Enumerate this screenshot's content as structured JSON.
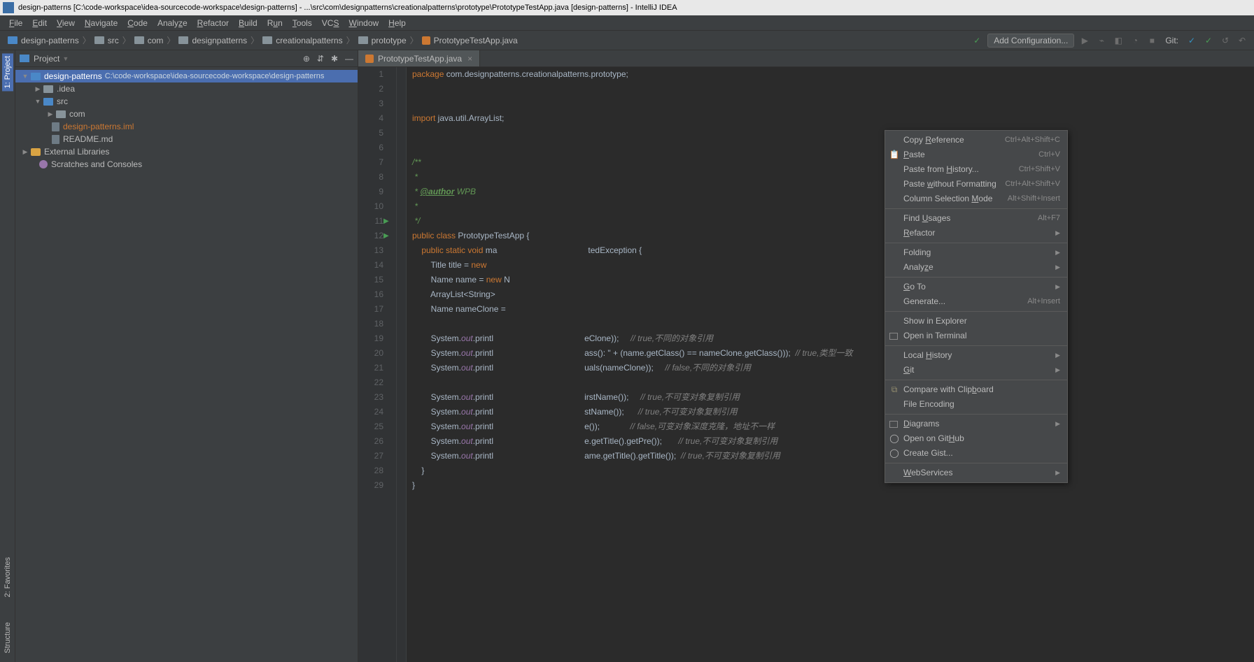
{
  "title": "design-patterns [C:\\code-workspace\\idea-sourcecode-workspace\\design-patterns] - ...\\src\\com\\designpatterns\\creationalpatterns\\prototype\\PrototypeTestApp.java [design-patterns] - IntelliJ IDEA",
  "menu": [
    "File",
    "Edit",
    "View",
    "Navigate",
    "Code",
    "Analyze",
    "Refactor",
    "Build",
    "Run",
    "Tools",
    "VCS",
    "Window",
    "Help"
  ],
  "breadcrumbs": [
    "design-patterns",
    "src",
    "com",
    "designpatterns",
    "creationalpatterns",
    "prototype",
    "PrototypeTestApp.java"
  ],
  "add_config": "Add Configuration...",
  "git_label": "Git:",
  "left_tabs": [
    "1: Project",
    "2: Favorites",
    "Structure"
  ],
  "project_header": "Project",
  "tree": {
    "root": "design-patterns",
    "root_path": "C:\\code-workspace\\idea-sourcecode-workspace\\design-patterns",
    "idea": ".idea",
    "src": "src",
    "com": "com",
    "iml": "design-patterns.iml",
    "readme": "README.md",
    "ext_lib": "External Libraries",
    "scratch": "Scratches and Consoles"
  },
  "tab_name": "PrototypeTestApp.java",
  "code_lines": {
    "l1_kw": "package",
    "l1_rest": " com.designpatterns.creationalpatterns.prototype;",
    "l4_kw": "import",
    "l4_rest": " java.util.ArrayList;",
    "l7": "/**",
    "l8": " *",
    "l9_pre": " * ",
    "l9_auth": "@author",
    "l9_post": " WPB",
    "l10": " *",
    "l11": " */",
    "l12_a": "public class ",
    "l12_b": "PrototypeTestApp {",
    "l13_a": "    public static void ",
    "l13_b": "ma",
    "l13_c": "tedException {",
    "l14_a": "        Title title = ",
    "l14_kw": "new",
    "l15_a": "        Name name = ",
    "l15_kw": "new ",
    "l15_b": "N",
    "l16": "        ArrayList<String>",
    "l17": "        Name nameClone = ",
    "l19_a": "        System.",
    "l19_out": "out",
    "l19_b": ".printl",
    "l19_c": "eClone));",
    "l19_cm": "// true,不同的对象引用",
    "l20_c": "ass(): \" + (name.getClass() == nameClone.getClass()));",
    "l20_cm": "// true,类型一致",
    "l21_c": "uals(nameClone));",
    "l21_cm": "// false,不同的对象引用",
    "l23_c": "irstName());",
    "l23_cm": "// true,不可变对象复制引用",
    "l24_c": "stName());",
    "l24_cm": "// true,不可变对象复制引用",
    "l25_c": "e());",
    "l25_cm": "// false,可变对象深度克隆，地址不一样",
    "l26_c": "e.getTitle().getPre());",
    "l26_cm": "// true,不可变对象复制引用",
    "l27_c": "ame.getTitle().getTitle());",
    "l27_cm": "// true,不可变对象复制引用",
    "l28": "    }",
    "l29": "}"
  },
  "context_menu": [
    {
      "label": "Copy Reference",
      "shortcut": "Ctrl+Alt+Shift+C",
      "u": "R"
    },
    {
      "label": "Paste",
      "shortcut": "Ctrl+V",
      "u": "P",
      "icon": "paste"
    },
    {
      "label": "Paste from History...",
      "shortcut": "Ctrl+Shift+V",
      "u": "H"
    },
    {
      "label": "Paste without Formatting",
      "shortcut": "Ctrl+Alt+Shift+V",
      "u": "w"
    },
    {
      "label": "Column Selection Mode",
      "shortcut": "Alt+Shift+Insert",
      "u": "M"
    },
    {
      "sep": true
    },
    {
      "label": "Find Usages",
      "shortcut": "Alt+F7",
      "u": "U"
    },
    {
      "label": "Refactor",
      "sub": true,
      "u": "R"
    },
    {
      "sep": true
    },
    {
      "label": "Folding",
      "sub": true
    },
    {
      "label": "Analyze",
      "sub": true,
      "u": "z"
    },
    {
      "sep": true
    },
    {
      "label": "Go To",
      "sub": true,
      "u": "G"
    },
    {
      "label": "Generate...",
      "shortcut": "Alt+Insert"
    },
    {
      "sep": true
    },
    {
      "label": "Show in Explorer"
    },
    {
      "label": "Open in Terminal",
      "icon": "term"
    },
    {
      "sep": true
    },
    {
      "label": "Local History",
      "sub": true,
      "u": "H"
    },
    {
      "label": "Git",
      "sub": true,
      "u": "G"
    },
    {
      "sep": true
    },
    {
      "label": "Compare with Clipboard",
      "icon": "clip",
      "u": "b"
    },
    {
      "label": "File Encoding"
    },
    {
      "sep": true
    },
    {
      "label": "Diagrams",
      "sub": true,
      "u": "D",
      "icon": "diag"
    },
    {
      "label": "Open on GitHub",
      "icon": "gh",
      "u": "H"
    },
    {
      "label": "Create Gist...",
      "icon": "gh"
    },
    {
      "sep": true
    },
    {
      "label": "WebServices",
      "sub": true,
      "u": "W"
    }
  ]
}
